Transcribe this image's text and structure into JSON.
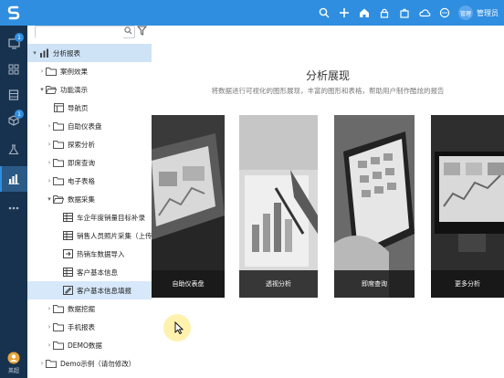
{
  "header": {
    "user_name": "管理员",
    "avatar_text": "管理",
    "icons": [
      "search-icon",
      "plus-icon",
      "home-icon",
      "lock-icon",
      "bag-icon",
      "cloud-icon",
      "chat-icon"
    ]
  },
  "leftnav": {
    "badges": [
      "1",
      "1"
    ],
    "bottom_label": "英超"
  },
  "tree": {
    "search_placeholder": "",
    "items": [
      {
        "label": "分析报表"
      },
      {
        "label": "案例效果"
      },
      {
        "label": "功能演示"
      },
      {
        "label": "导航页"
      },
      {
        "label": "自助仪表盘"
      },
      {
        "label": "探索分析"
      },
      {
        "label": "即席查询"
      },
      {
        "label": "电子表格"
      },
      {
        "label": "数据采集"
      },
      {
        "label": "车企年度销量目标补录"
      },
      {
        "label": "销售人员照片采集（上传附件）"
      },
      {
        "label": "热销车数据导入"
      },
      {
        "label": "客户基本信息"
      },
      {
        "label": "客户基本信息填报"
      },
      {
        "label": "数据挖掘"
      },
      {
        "label": "手机报表"
      },
      {
        "label": "DEMO数据"
      },
      {
        "label": "Demo示例（请勿修改）"
      }
    ]
  },
  "main": {
    "title": "分析展现",
    "subtitle": "将数据进行可视化的图形展现，丰富的图形和表格，帮助用户制作酷炫的报告",
    "cards": [
      {
        "caption": "自助仪表盘"
      },
      {
        "caption": "透视分析"
      },
      {
        "caption": "即席查询"
      },
      {
        "caption": "更多分析"
      }
    ]
  },
  "colors": {
    "primary": "#2f8ee0",
    "nav_bg": "#17324f",
    "selected_row": "#cfe3f7"
  }
}
